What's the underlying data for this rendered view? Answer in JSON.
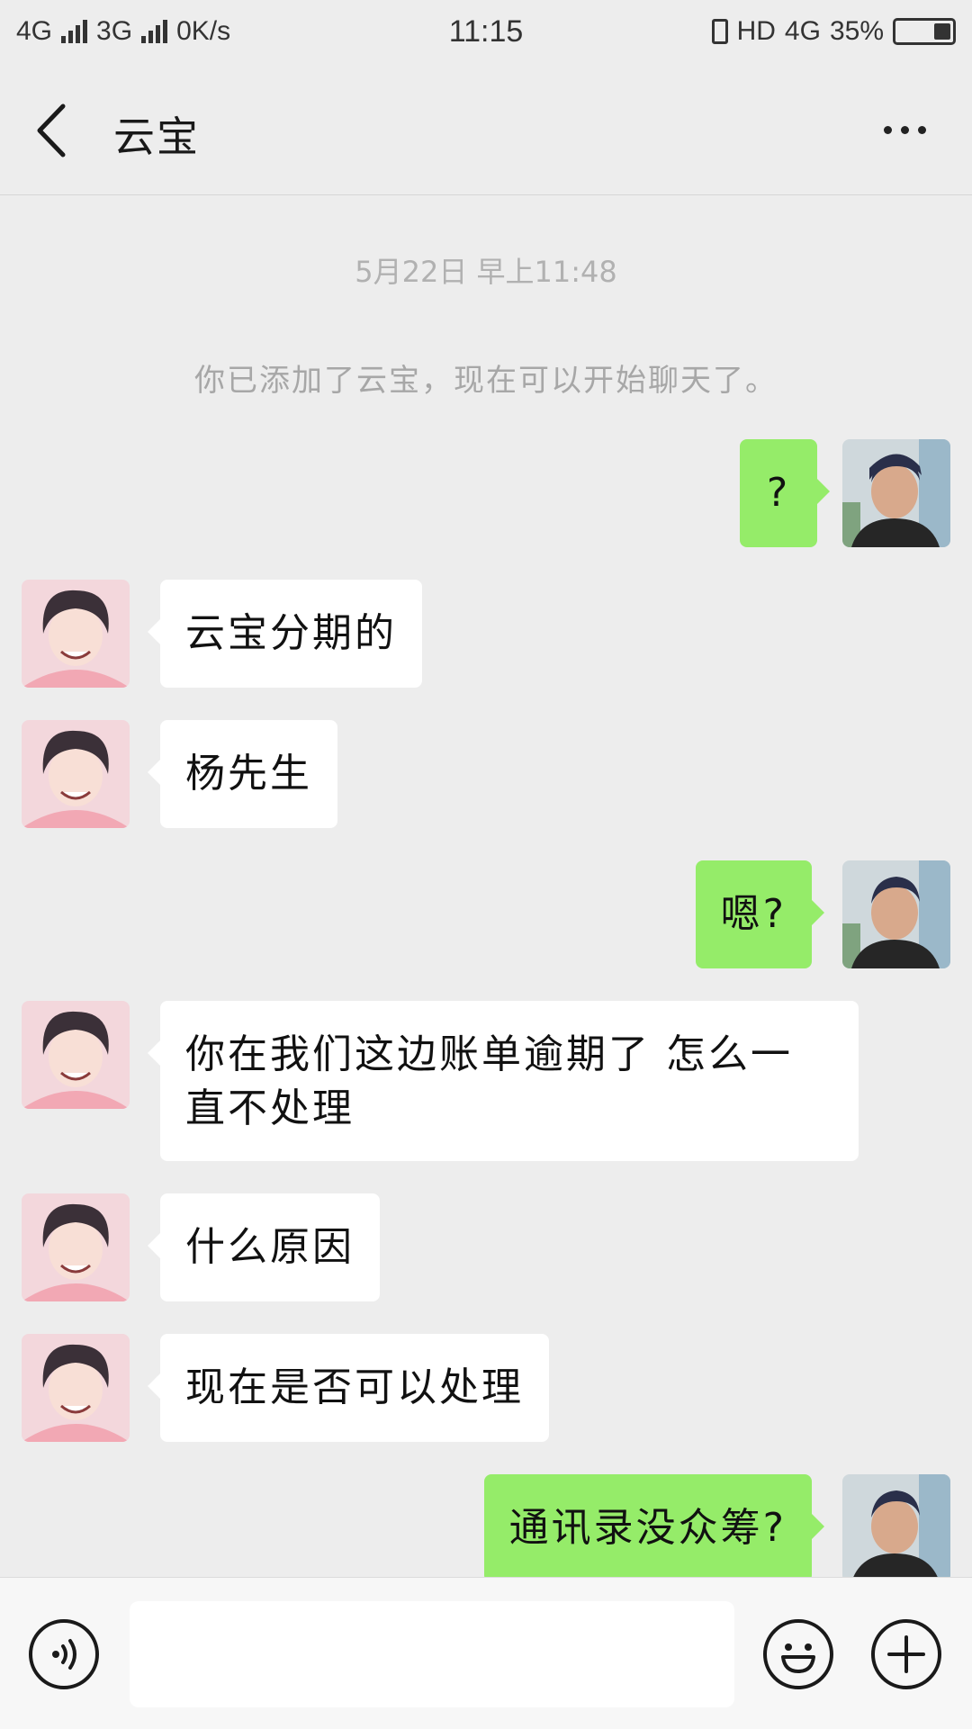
{
  "status_bar": {
    "net1": "4G",
    "net2": "3G",
    "speed": "0K/s",
    "time": "11:15",
    "hd": "HD",
    "net3": "4G",
    "battery": "35%"
  },
  "header": {
    "title": "云宝",
    "back_icon": "chevron-left-icon",
    "more_icon": "more-dots-icon"
  },
  "chat": {
    "timestamp": "5月22日 早上11:48",
    "system_message": "你已添加了云宝，现在可以开始聊天了。",
    "messages": [
      {
        "from": "me",
        "text": "?"
      },
      {
        "from": "contact",
        "text": "云宝分期的"
      },
      {
        "from": "contact",
        "text": "杨先生"
      },
      {
        "from": "me",
        "text": "嗯?"
      },
      {
        "from": "contact",
        "text": "你在我们这边账单逾期了 怎么一直不处理"
      },
      {
        "from": "contact",
        "text": "什么原因"
      },
      {
        "from": "contact",
        "text": "现在是否可以处理"
      },
      {
        "from": "me",
        "text": "通讯录没众筹?"
      }
    ]
  },
  "bottom_bar": {
    "voice_icon": "voice-icon",
    "emoji_icon": "emoji-icon",
    "plus_icon": "plus-icon",
    "input_value": ""
  },
  "colors": {
    "background": "#ededed",
    "outgoing_bubble": "#95ec69",
    "incoming_bubble": "#ffffff"
  }
}
